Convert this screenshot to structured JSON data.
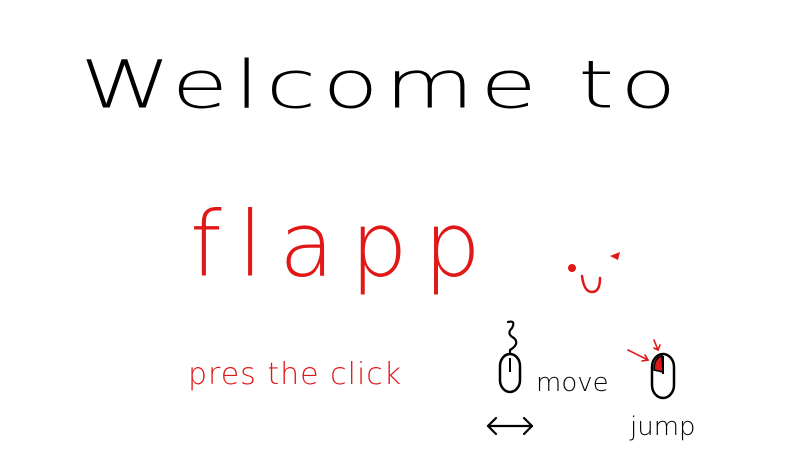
{
  "screen": {
    "title": "Welcome to",
    "game_name": "flapp",
    "instruction": "pres the click"
  },
  "controls": {
    "move_label": "move",
    "jump_label": "jump",
    "move_icon": "mouse-icon",
    "jump_icon": "mouse-left-click-icon",
    "move_arrow_icon": "left-right-arrow-icon"
  },
  "mascot": {
    "icon": "smiley-face-icon"
  },
  "colors": {
    "background": "#ffffff",
    "ink": "#000000",
    "accent": "#e01818"
  }
}
